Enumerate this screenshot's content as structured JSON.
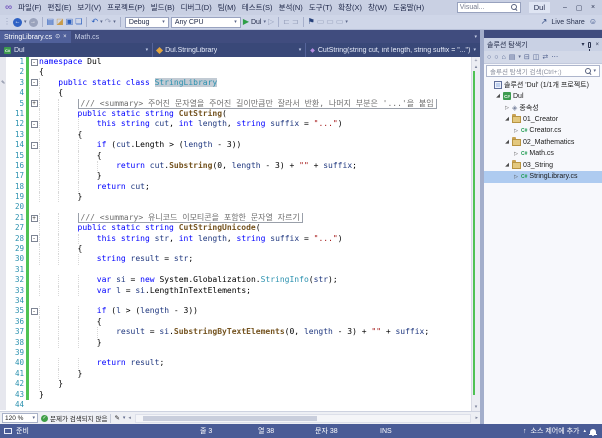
{
  "window": {
    "menu_items": [
      "파일(F)",
      "편집(E)",
      "보기(V)",
      "프로젝트(P)",
      "빌드(B)",
      "디버그(D)",
      "팀(M)",
      "테스트(S)",
      "분석(N)",
      "도구(T)",
      "확장(X)",
      "창(W)",
      "도움말(H)"
    ],
    "search_placeholder": "Visual...",
    "title": "Dul"
  },
  "toolbar": {
    "config": "Debug",
    "platform": "Any CPU",
    "run_target": "Dul",
    "live_share": "Live Share"
  },
  "tabs": [
    {
      "label": "StringLibrary.cs",
      "active": true
    },
    {
      "label": "Math.cs",
      "active": false
    }
  ],
  "navbar": {
    "project": "Dul",
    "type": "Dul.StringLibrary",
    "member": "CutString(string cut, int length, string suffix = \"...\")"
  },
  "editor": {
    "zoom_level": "120 %",
    "health_message": "문제가 검색되지 않음",
    "lines": [
      {
        "n": 1,
        "ind": 0,
        "fold": "minus",
        "tok": [
          [
            "k",
            "namespace"
          ],
          [
            "p",
            " Dul"
          ]
        ]
      },
      {
        "n": 2,
        "ind": 0,
        "tok": [
          [
            "p",
            "{"
          ]
        ]
      },
      {
        "n": 3,
        "ind": 1,
        "fold": "minus",
        "pencil": true,
        "tok": [
          [
            "k",
            "public static class"
          ],
          [
            "p",
            " "
          ],
          [
            "hl",
            "StringLibrary"
          ]
        ]
      },
      {
        "n": 4,
        "ind": 1,
        "tok": [
          [
            "p",
            "{"
          ]
        ]
      },
      {
        "n": 5,
        "ind": 2,
        "fold": "plus",
        "box": true,
        "tok": [
          [
            "c",
            "/// <summary> 주어진 문자열을 주어진 길이만큼만 잘라서 반환, 나머지 부분은 '...'을 붙임"
          ]
        ]
      },
      {
        "n": 11,
        "ind": 2,
        "tok": [
          [
            "k",
            "public static string"
          ],
          [
            "p",
            " "
          ],
          [
            "m",
            "CutString"
          ],
          [
            "p",
            "("
          ]
        ]
      },
      {
        "n": 12,
        "ind": 3,
        "fold": "minus",
        "tok": [
          [
            "k",
            "this string"
          ],
          [
            "p",
            " "
          ],
          [
            "v",
            "cut"
          ],
          [
            "p",
            ", "
          ],
          [
            "k",
            "int"
          ],
          [
            "p",
            " "
          ],
          [
            "v",
            "length"
          ],
          [
            "p",
            ", "
          ],
          [
            "k",
            "string"
          ],
          [
            "p",
            " "
          ],
          [
            "v",
            "suffix"
          ],
          [
            "p",
            " = "
          ],
          [
            "s",
            "\"...\""
          ],
          [
            "p",
            ")"
          ]
        ]
      },
      {
        "n": 13,
        "ind": 2,
        "tok": [
          [
            "p",
            "{"
          ]
        ]
      },
      {
        "n": 14,
        "ind": 3,
        "fold": "minus",
        "tok": [
          [
            "k",
            "if"
          ],
          [
            "p",
            " ("
          ],
          [
            "v",
            "cut"
          ],
          [
            "p",
            ".Length > ("
          ],
          [
            "v",
            "length"
          ],
          [
            "p",
            " - 3))"
          ]
        ]
      },
      {
        "n": 15,
        "ind": 3,
        "tok": [
          [
            "p",
            "{"
          ]
        ]
      },
      {
        "n": 16,
        "ind": 4,
        "tok": [
          [
            "k",
            "return"
          ],
          [
            "p",
            " "
          ],
          [
            "v",
            "cut"
          ],
          [
            "p",
            "."
          ],
          [
            "m",
            "Substring"
          ],
          [
            "p",
            "(0, "
          ],
          [
            "v",
            "length"
          ],
          [
            "p",
            " - 3) + "
          ],
          [
            "s",
            "\"\""
          ],
          [
            "p",
            " + "
          ],
          [
            "v",
            "suffix"
          ],
          [
            "p",
            ";"
          ]
        ]
      },
      {
        "n": 17,
        "ind": 3,
        "tok": [
          [
            "p",
            "}"
          ]
        ]
      },
      {
        "n": 18,
        "ind": 3,
        "tok": [
          [
            "k",
            "return"
          ],
          [
            "p",
            " "
          ],
          [
            "v",
            "cut"
          ],
          [
            "p",
            ";"
          ]
        ]
      },
      {
        "n": 19,
        "ind": 2,
        "tok": [
          [
            "p",
            "}"
          ]
        ]
      },
      {
        "n": 20,
        "ind": 0,
        "tok": []
      },
      {
        "n": 21,
        "ind": 2,
        "fold": "plus",
        "box": true,
        "tok": [
          [
            "c",
            "/// <summary> 유니코드 이모티콘을 포함한 문자열 자르기"
          ]
        ]
      },
      {
        "n": 27,
        "ind": 2,
        "tok": [
          [
            "k",
            "public static string"
          ],
          [
            "p",
            " "
          ],
          [
            "m",
            "CutStringUnicode"
          ],
          [
            "p",
            "("
          ]
        ]
      },
      {
        "n": 28,
        "ind": 3,
        "fold": "minus",
        "tok": [
          [
            "k",
            "this string"
          ],
          [
            "p",
            " "
          ],
          [
            "v",
            "str"
          ],
          [
            "p",
            ", "
          ],
          [
            "k",
            "int"
          ],
          [
            "p",
            " "
          ],
          [
            "v",
            "length"
          ],
          [
            "p",
            ", "
          ],
          [
            "k",
            "string"
          ],
          [
            "p",
            " "
          ],
          [
            "v",
            "suffix"
          ],
          [
            "p",
            " = "
          ],
          [
            "s",
            "\"...\""
          ],
          [
            "p",
            ")"
          ]
        ]
      },
      {
        "n": 29,
        "ind": 2,
        "tok": [
          [
            "p",
            "{"
          ]
        ]
      },
      {
        "n": 30,
        "ind": 3,
        "tok": [
          [
            "k",
            "string"
          ],
          [
            "p",
            " "
          ],
          [
            "v",
            "result"
          ],
          [
            "p",
            " = "
          ],
          [
            "v",
            "str"
          ],
          [
            "p",
            ";"
          ]
        ]
      },
      {
        "n": 31,
        "ind": 0,
        "tok": []
      },
      {
        "n": 32,
        "ind": 3,
        "tok": [
          [
            "k",
            "var"
          ],
          [
            "p",
            " "
          ],
          [
            "v",
            "si"
          ],
          [
            "p",
            " = "
          ],
          [
            "k",
            "new"
          ],
          [
            "p",
            " System.Globalization."
          ],
          [
            "t",
            "StringInfo"
          ],
          [
            "p",
            "("
          ],
          [
            "v",
            "str"
          ],
          [
            "p",
            ");"
          ]
        ]
      },
      {
        "n": 33,
        "ind": 3,
        "tok": [
          [
            "k",
            "var"
          ],
          [
            "p",
            " "
          ],
          [
            "v",
            "l"
          ],
          [
            "p",
            " = "
          ],
          [
            "v",
            "si"
          ],
          [
            "p",
            ".LengthInTextElements;"
          ]
        ]
      },
      {
        "n": 34,
        "ind": 0,
        "tok": []
      },
      {
        "n": 35,
        "ind": 3,
        "fold": "minus",
        "tok": [
          [
            "k",
            "if"
          ],
          [
            "p",
            " ("
          ],
          [
            "v",
            "l"
          ],
          [
            "p",
            " > ("
          ],
          [
            "v",
            "length"
          ],
          [
            "p",
            " - 3))"
          ]
        ]
      },
      {
        "n": 36,
        "ind": 3,
        "tok": [
          [
            "p",
            "{"
          ]
        ]
      },
      {
        "n": 37,
        "ind": 4,
        "tok": [
          [
            "v",
            "result"
          ],
          [
            "p",
            " = "
          ],
          [
            "v",
            "si"
          ],
          [
            "p",
            "."
          ],
          [
            "m",
            "SubstringByTextElements"
          ],
          [
            "p",
            "(0, "
          ],
          [
            "v",
            "length"
          ],
          [
            "p",
            " - 3) + "
          ],
          [
            "s",
            "\"\""
          ],
          [
            "p",
            " + "
          ],
          [
            "v",
            "suffix"
          ],
          [
            "p",
            ";"
          ]
        ]
      },
      {
        "n": 38,
        "ind": 3,
        "tok": [
          [
            "p",
            "}"
          ]
        ]
      },
      {
        "n": 39,
        "ind": 0,
        "tok": []
      },
      {
        "n": 40,
        "ind": 3,
        "tok": [
          [
            "k",
            "return"
          ],
          [
            "p",
            " "
          ],
          [
            "v",
            "result"
          ],
          [
            "p",
            ";"
          ]
        ]
      },
      {
        "n": 41,
        "ind": 2,
        "tok": [
          [
            "p",
            "}"
          ]
        ]
      },
      {
        "n": 42,
        "ind": 1,
        "tok": [
          [
            "p",
            "}"
          ]
        ]
      },
      {
        "n": 43,
        "ind": 0,
        "tok": [
          [
            "p",
            "}"
          ]
        ]
      },
      {
        "n": 44,
        "ind": 0,
        "nochg": true,
        "tok": []
      }
    ]
  },
  "solution_explorer": {
    "title": "솔루션 탐색기",
    "search_placeholder": "솔루션 탐색기 검색(Ctrl+;)",
    "tree": [
      {
        "icon": "solution",
        "label": "솔루션 'Dul' (1/1개 프로젝트)",
        "level": 0
      },
      {
        "icon": "csproj",
        "label": "Dul",
        "level": 1,
        "exp": "open"
      },
      {
        "icon": "deps",
        "label": "종속성",
        "level": 2,
        "exp": "closed"
      },
      {
        "icon": "folder",
        "label": "01_Creator",
        "level": 2,
        "exp": "open"
      },
      {
        "icon": "csfile",
        "label": "Creator.cs",
        "level": 3,
        "exp": "closed"
      },
      {
        "icon": "folder",
        "label": "02_Mathematics",
        "level": 2,
        "exp": "open"
      },
      {
        "icon": "csfile",
        "label": "Math.cs",
        "level": 3,
        "exp": "closed"
      },
      {
        "icon": "folder",
        "label": "03_String",
        "level": 2,
        "exp": "open"
      },
      {
        "icon": "csfile",
        "label": "StringLibrary.cs",
        "level": 3,
        "exp": "closed",
        "selected": true
      }
    ]
  },
  "status_bar": {
    "ready": "준비",
    "line": "줄 3",
    "column": "열 38",
    "character": "문자 38",
    "mode": "INS",
    "source_control": "소스 제어에 추가"
  },
  "colors": {
    "keyword": "#0000FF",
    "type": "#2B91AF",
    "method": "#74531F",
    "string_literal": "#A31515",
    "identifier": "#1F377F",
    "line_number": "#2B91AF",
    "change_bar": "#4FC253",
    "status_bar": "#4A5C96",
    "symbol_highlight": "#C2CBD4"
  },
  "glyphs": {
    "vs-logo": "∞",
    "grip": "⋮",
    "navigate-back": "←",
    "navigate-forward": "→",
    "caret": "▾",
    "new-file": "▤",
    "open-folder": "◪",
    "save": "▣",
    "save-all": "❏",
    "undo": "↶",
    "redo": "↷",
    "play": "▶",
    "attach": "▷",
    "list1": "⊏",
    "list2": "⊐",
    "bookmark": "⚑",
    "win-rect": "▭",
    "live-share": "↗",
    "feedback": "☺",
    "min": "–",
    "max": "▢",
    "close": "×",
    "tab-pin": "⊙",
    "home": "⌂",
    "circle": "○",
    "switch-views": "▤",
    "collapse-all": "⊟",
    "show-all": "◫",
    "sync": "⇄",
    "more": "⋯",
    "expander-open": "◢",
    "expander-closed": "▷",
    "scroll-up": "▴",
    "scroll-down": "▾",
    "scroll-left": "◂",
    "scroll-right": "▸",
    "split": "+",
    "check": "✓",
    "pencil": "✎",
    "up-arrow": "↑",
    "popup-caret": "▴",
    "deps": "◈"
  }
}
